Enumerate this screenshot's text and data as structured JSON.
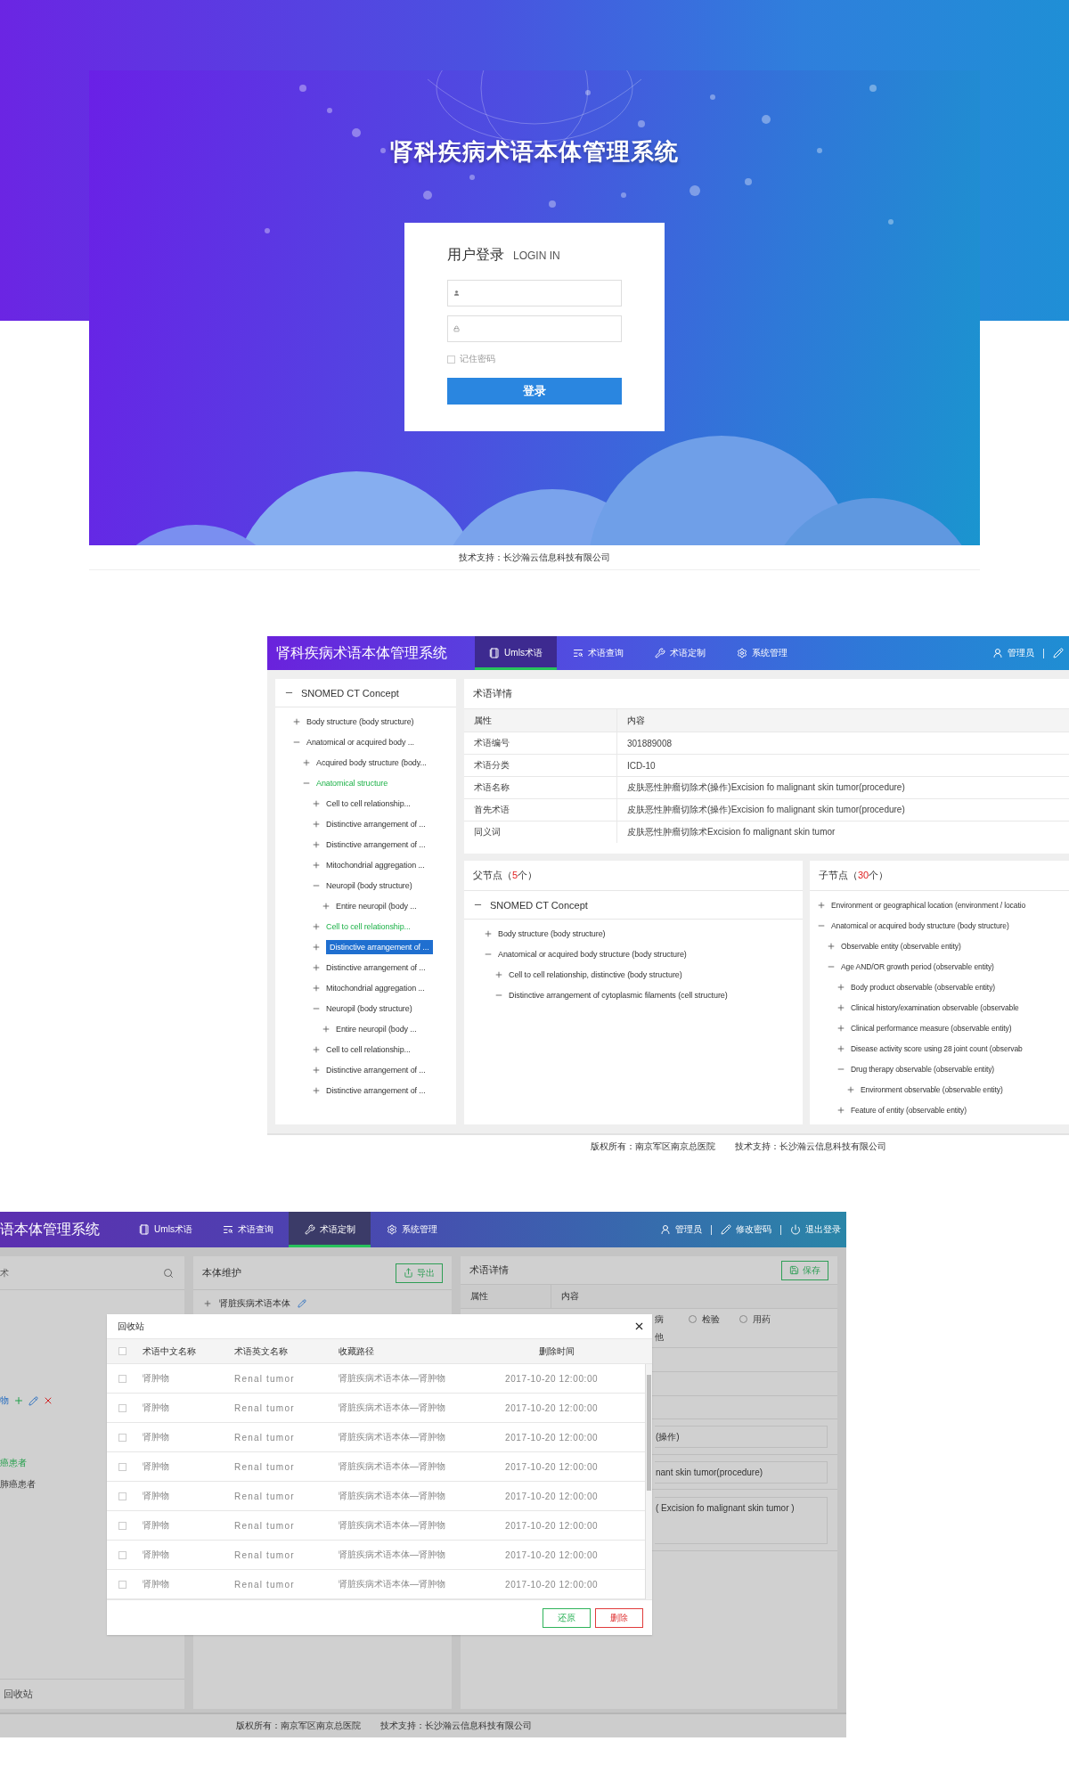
{
  "login": {
    "title": "肾科疾病术语本体管理系统",
    "heading": "用户登录",
    "heading_en": "LOGIN IN",
    "remember": {
      "label": "记住密码",
      "checked": false
    },
    "submit": "登录",
    "footer": "技术支持：长沙瀚云信息科技有限公司"
  },
  "browser": {
    "header": {
      "title": "肾科疾病术语本体管理系统",
      "tabs": [
        {
          "label": "Umls术语",
          "selected": true
        },
        {
          "label": "术语查询",
          "selected": false
        },
        {
          "label": "术语定制",
          "selected": false
        },
        {
          "label": "系统管理",
          "selected": false
        }
      ],
      "user": "管理员"
    },
    "concept_tree": {
      "label": "SNOMED CT Concept",
      "expanded": true,
      "children": [
        {
          "label": "Body structure (body structure)",
          "expanded": false,
          "selected": false,
          "highlighted": false
        },
        {
          "label": "Anatomical or acquired body ...",
          "expanded": true,
          "selected": false,
          "highlighted": false,
          "children": [
            {
              "label": "Acquired body structure (body...",
              "expanded": false,
              "selected": false,
              "highlighted": false
            },
            {
              "label": "Anatomical structure",
              "expanded": true,
              "selected": false,
              "highlighted": true,
              "children": [
                {
                  "label": "Cell to cell relationship...",
                  "expanded": false,
                  "selected": false,
                  "highlighted": false
                },
                {
                  "label": "Distinctive arrangement of ...",
                  "expanded": false,
                  "selected": false,
                  "highlighted": false
                },
                {
                  "label": "Distinctive arrangement of ...",
                  "expanded": false,
                  "selected": false,
                  "highlighted": false
                },
                {
                  "label": "Mitochondrial aggregation ...",
                  "expanded": false,
                  "selected": false,
                  "highlighted": false
                },
                {
                  "label": "Neuropil (body structure)",
                  "expanded": true,
                  "selected": false,
                  "highlighted": false,
                  "children": [
                    {
                      "label": "Entire neuropil (body ...",
                      "expanded": false,
                      "selected": false,
                      "highlighted": false
                    }
                  ]
                },
                {
                  "label": "Cell to cell relationship...",
                  "expanded": false,
                  "selected": false,
                  "highlighted": true
                },
                {
                  "label": "Distinctive arrangement of ...",
                  "expanded": false,
                  "selected": true,
                  "highlighted": false
                },
                {
                  "label": "Distinctive arrangement of ...",
                  "expanded": false,
                  "selected": false,
                  "highlighted": false
                },
                {
                  "label": "Mitochondrial aggregation ...",
                  "expanded": false,
                  "selected": false,
                  "highlighted": false
                },
                {
                  "label": "Neuropil (body structure)",
                  "expanded": true,
                  "selected": false,
                  "highlighted": false,
                  "children": [
                    {
                      "label": "Entire neuropil (body ...",
                      "expanded": false,
                      "selected": false,
                      "highlighted": false
                    }
                  ]
                },
                {
                  "label": "Cell to cell relationship...",
                  "expanded": false,
                  "selected": false,
                  "highlighted": false
                },
                {
                  "label": "Distinctive arrangement of ...",
                  "expanded": false,
                  "selected": false,
                  "highlighted": false
                },
                {
                  "label": "Distinctive arrangement of ...",
                  "expanded": false,
                  "selected": false,
                  "highlighted": false
                }
              ]
            }
          ]
        }
      ]
    },
    "details": {
      "title": "术语详情",
      "columns": [
        "属性",
        "内容"
      ],
      "rows": [
        {
          "attribute": "术语编号",
          "value": "301889008"
        },
        {
          "attribute": "术语分类",
          "value": "ICD-10"
        },
        {
          "attribute": "术语名称",
          "value": "皮肤恶性肿瘤切除术(操作)Excision fo malignant skin tumor(procedure)"
        },
        {
          "attribute": "首先术语",
          "value": "皮肤恶性肿瘤切除术(操作)Excision fo malignant skin tumor(procedure)"
        },
        {
          "attribute": "同义词",
          "value": "皮肤恶性肿瘤切除术Excision fo malignant skin tumor"
        }
      ]
    },
    "parents": {
      "title": "父节点（",
      "count": "5",
      "suffix": "个）",
      "root": {
        "label": "SNOMED CT Concept",
        "expanded": true,
        "children": [
          {
            "label": "Body structure (body structure)",
            "expanded": false
          },
          {
            "label": "Anatomical or acquired body structure (body structure)",
            "expanded": true,
            "children": [
              {
                "label": "Cell to cell relationship, distinctive (body structure)",
                "expanded": false
              },
              {
                "label": "Distinctive arrangement of cytoplasmic filaments (cell structure)",
                "expanded": true
              }
            ]
          }
        ]
      }
    },
    "children_panel": {
      "title": "子节点（",
      "count": "30",
      "suffix": "个）",
      "items": [
        {
          "label": "Environment or geographical location (environment / locatio",
          "expanded": false
        },
        {
          "label": "Anatomical or acquired body structure (body structure)",
          "expanded": true,
          "children": [
            {
              "label": "Observable entity (observable entity)",
              "expanded": false
            },
            {
              "label": "Age AND/OR growth period (observable entity)",
              "expanded": true,
              "children": [
                {
                  "label": "Body product observable (observable entity)",
                  "expanded": false
                },
                {
                  "label": "Clinical history/examination observable (observable",
                  "expanded": false
                },
                {
                  "label": "Clinical performance measure (observable entity)",
                  "expanded": false
                },
                {
                  "label": "Disease activity score using 28 joint count (observab",
                  "expanded": false
                },
                {
                  "label": "Drug therapy observable (observable entity)",
                  "expanded": true,
                  "children": [
                    {
                      "label": "Environment observable (observable entity)",
                      "expanded": false
                    }
                  ]
                },
                {
                  "label": "Feature of entity (observable entity)",
                  "expanded": false
                }
              ]
            }
          ]
        }
      ]
    },
    "footer": [
      "版权所有：南京军区南京总医院",
      "技术支持：长沙瀚云信息科技有限公司"
    ]
  },
  "customizer": {
    "header": {
      "title": "语本体管理系统",
      "tabs": [
        {
          "label": "Umls术语",
          "selected": false
        },
        {
          "label": "术语查询",
          "selected": false
        },
        {
          "label": "术语定制",
          "selected": true
        },
        {
          "label": "系统管理",
          "selected": false
        }
      ],
      "user": "管理员",
      "actions": [
        "修改密码",
        "退出登录"
      ]
    },
    "left": {
      "search_placeholder": "术",
      "items": [
        {
          "label": "物",
          "editing": true,
          "highlighted": false
        },
        {
          "label": "癌患者",
          "editing": false,
          "highlighted": true
        },
        {
          "label": "肺癌患者",
          "editing": false,
          "highlighted": false
        }
      ],
      "recycle": "回收站"
    },
    "center": {
      "title": "本体维护",
      "export_button": "导出",
      "root": {
        "label": "肾脏疾病术语本体",
        "expanded": false
      }
    },
    "right": {
      "title": "术语详情",
      "save_button": "保存",
      "columns": [
        "属性",
        "内容"
      ],
      "radio_fragments": [
        "病",
        "他"
      ],
      "radios": [
        {
          "label": "检验",
          "selected": false
        },
        {
          "label": "用药",
          "selected": false
        }
      ],
      "fields": [
        "(操作)",
        "nant skin tumor(procedure)"
      ],
      "textarea": "( Excision fo malignant skin tumor )"
    },
    "footer": [
      "版权所有：南京军区南京总医院",
      "技术支持：长沙瀚云信息科技有限公司"
    ],
    "modal": {
      "title": "回收站",
      "select_all": false,
      "columns": [
        "术语中文名称",
        "术语英文名称",
        "收藏路径",
        "删除时间"
      ],
      "rows": [
        {
          "checked": false,
          "cells": [
            "肾肿物",
            "Renal tumor",
            "肾脏疾病术语本体—肾肿物",
            "2017-10-20 12:00:00"
          ]
        },
        {
          "checked": false,
          "cells": [
            "肾肿物",
            "Renal tumor",
            "肾脏疾病术语本体—肾肿物",
            "2017-10-20 12:00:00"
          ]
        },
        {
          "checked": false,
          "cells": [
            "肾肿物",
            "Renal tumor",
            "肾脏疾病术语本体—肾肿物",
            "2017-10-20 12:00:00"
          ]
        },
        {
          "checked": false,
          "cells": [
            "肾肿物",
            "Renal tumor",
            "肾脏疾病术语本体—肾肿物",
            "2017-10-20 12:00:00"
          ]
        },
        {
          "checked": false,
          "cells": [
            "肾肿物",
            "Renal tumor",
            "肾脏疾病术语本体—肾肿物",
            "2017-10-20 12:00:00"
          ]
        },
        {
          "checked": false,
          "cells": [
            "肾肿物",
            "Renal tumor",
            "肾脏疾病术语本体—肾肿物",
            "2017-10-20 12:00:00"
          ]
        },
        {
          "checked": false,
          "cells": [
            "肾肿物",
            "Renal tumor",
            "肾脏疾病术语本体—肾肿物",
            "2017-10-20 12:00:00"
          ]
        },
        {
          "checked": false,
          "cells": [
            "肾肿物",
            "Renal tumor",
            "肾脏疾病术语本体—肾肿物",
            "2017-10-20 12:00:00"
          ]
        }
      ],
      "restore_button": "还原",
      "delete_button": "删除"
    }
  }
}
